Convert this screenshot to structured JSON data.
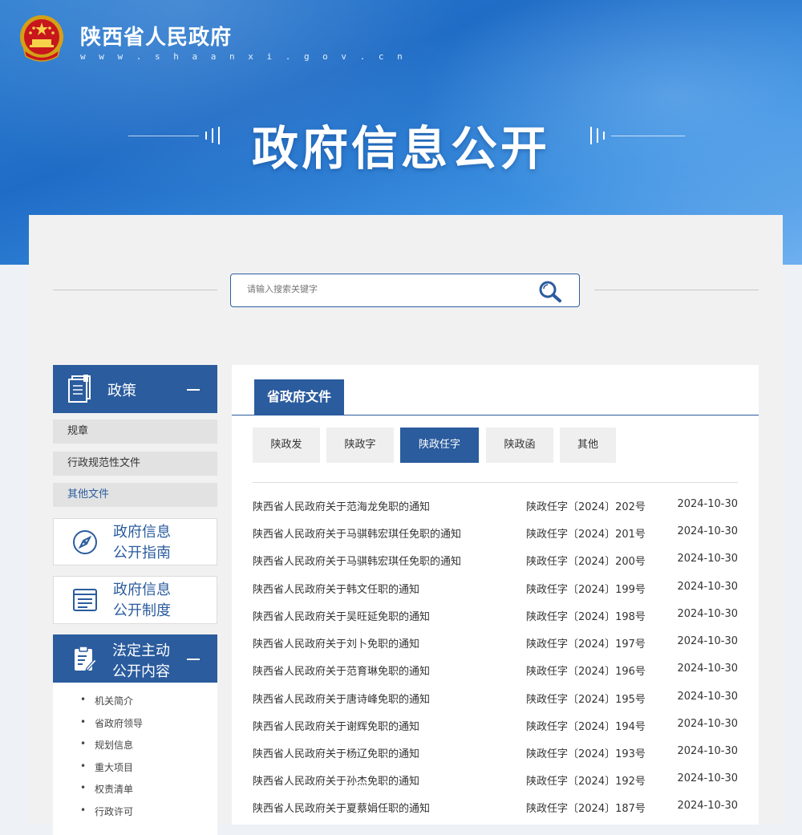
{
  "header": {
    "site_name": "陕西省人民政府",
    "site_url": "w w w . s h a a n x i . g o v . c n",
    "page_title": "政府信息公开",
    "emblem_icon": "national-emblem-icon"
  },
  "search": {
    "placeholder": "请输入搜索关键字",
    "icon": "search-icon"
  },
  "sidebar": {
    "policy_header": "政策",
    "policy_items": [
      "规章",
      "行政规范性文件",
      "其他文件"
    ],
    "guide_label_1": "政府信息",
    "guide_label_2": "公开指南",
    "system_label_1": "政府信息",
    "system_label_2": "公开制度",
    "statutory_label_1": "法定主动",
    "statutory_label_2": "公开内容",
    "statutory_items": [
      "机关简介",
      "省政府领导",
      "规划信息",
      "重大项目",
      "权责清单",
      "行政许可"
    ]
  },
  "main": {
    "section_tab": "省政府文件",
    "subtabs": [
      "陕政发",
      "陕政字",
      "陕政任字",
      "陕政函",
      "其他"
    ],
    "active_subtab": "陕政任字",
    "rows": [
      {
        "title": "陕西省人民政府关于范海龙免职的通知",
        "doc_no": "陕政任字〔2024〕202号",
        "date": "2024-10-30"
      },
      {
        "title": "陕西省人民政府关于马骐韩宏琪任免职的通知",
        "doc_no": "陕政任字〔2024〕201号",
        "date": "2024-10-30"
      },
      {
        "title": "陕西省人民政府关于马骐韩宏琪任免职的通知",
        "doc_no": "陕政任字〔2024〕200号",
        "date": "2024-10-30"
      },
      {
        "title": "陕西省人民政府关于韩文任职的通知",
        "doc_no": "陕政任字〔2024〕199号",
        "date": "2024-10-30"
      },
      {
        "title": "陕西省人民政府关于吴旺延免职的通知",
        "doc_no": "陕政任字〔2024〕198号",
        "date": "2024-10-30"
      },
      {
        "title": "陕西省人民政府关于刘卜免职的通知",
        "doc_no": "陕政任字〔2024〕197号",
        "date": "2024-10-30"
      },
      {
        "title": "陕西省人民政府关于范育琳免职的通知",
        "doc_no": "陕政任字〔2024〕196号",
        "date": "2024-10-30"
      },
      {
        "title": "陕西省人民政府关于唐诗峰免职的通知",
        "doc_no": "陕政任字〔2024〕195号",
        "date": "2024-10-30"
      },
      {
        "title": "陕西省人民政府关于谢辉免职的通知",
        "doc_no": "陕政任字〔2024〕194号",
        "date": "2024-10-30"
      },
      {
        "title": "陕西省人民政府关于杨辽免职的通知",
        "doc_no": "陕政任字〔2024〕193号",
        "date": "2024-10-30"
      },
      {
        "title": "陕西省人民政府关于孙杰免职的通知",
        "doc_no": "陕政任字〔2024〕192号",
        "date": "2024-10-30"
      },
      {
        "title": "陕西省人民政府关于夏蔡娟任职的通知",
        "doc_no": "陕政任字〔2024〕187号",
        "date": "2024-10-30"
      }
    ]
  },
  "colors": {
    "brand_blue": "#2b5c9e",
    "hero_blue": "#2f7fd1"
  }
}
